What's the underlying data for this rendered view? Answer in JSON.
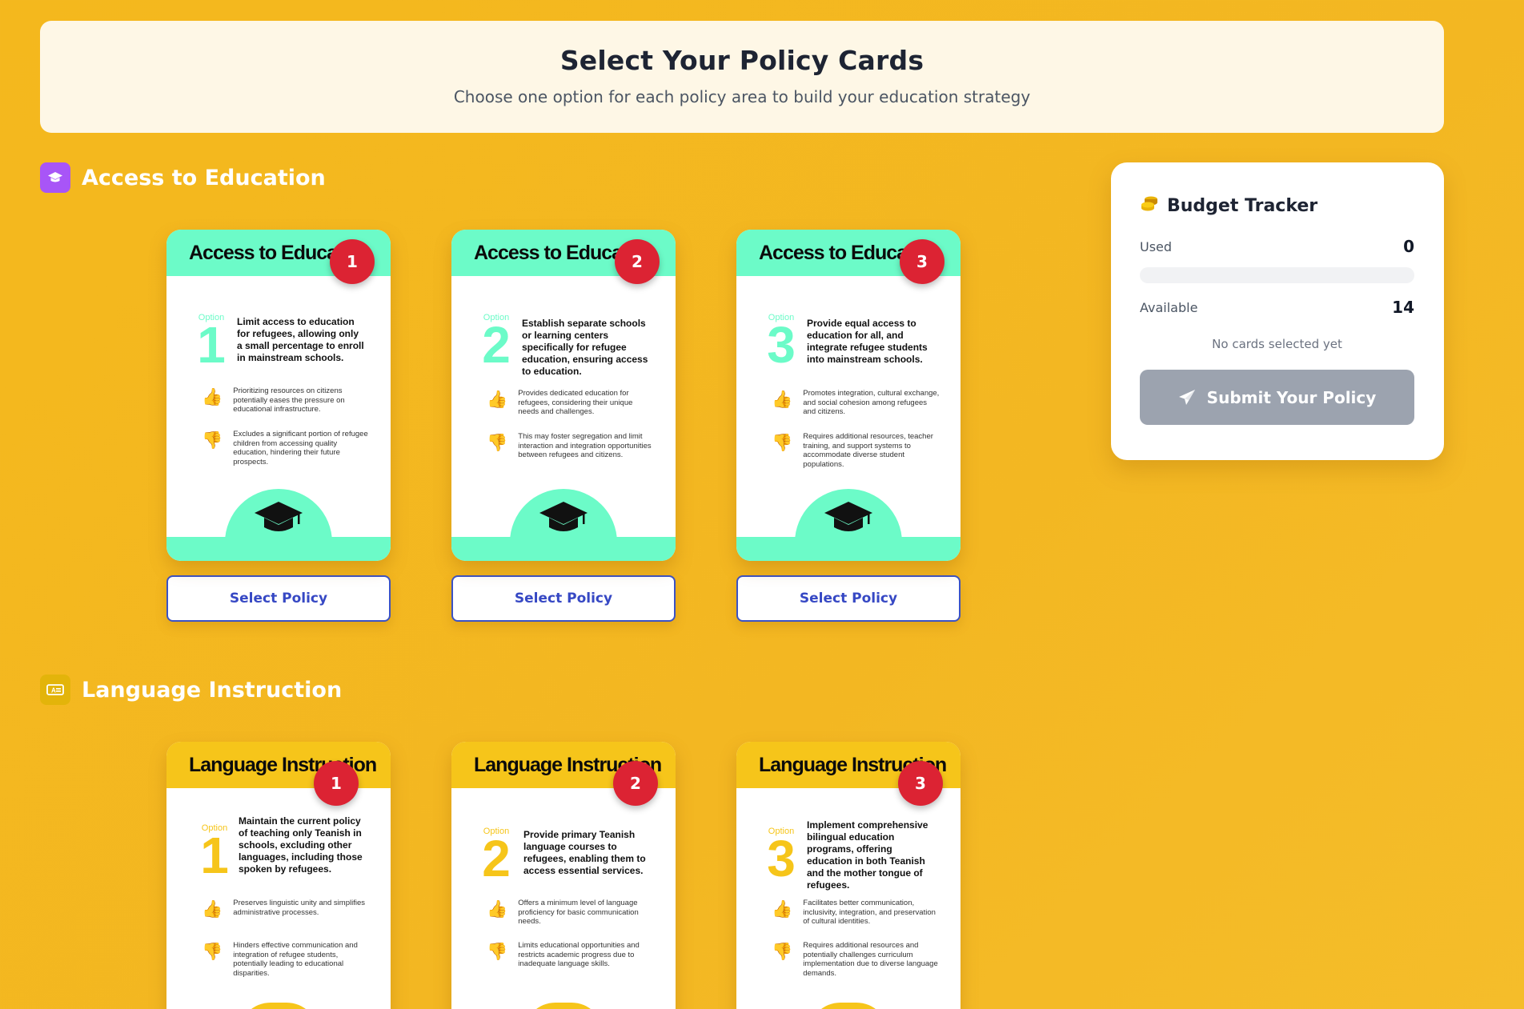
{
  "header": {
    "title": "Select Your Policy Cards",
    "subtitle": "Choose one option for each policy area to build your education strategy"
  },
  "sections": [
    {
      "title": "Access to Education",
      "icon": "graduation-cap-icon",
      "icon_bg": "#a855f7",
      "accent": "#6cfbc8",
      "cards": [
        {
          "header": "Access to Education",
          "badge": "1",
          "option_label": "Option",
          "option_number": "1",
          "title": "Limit access to education for refugees, allowing only a small percentage to enroll in mainstream schools.",
          "pro": "Prioritizing resources on citizens potentially eases the pressure on educational infrastructure.",
          "con": "Excludes a significant portion of refugee children from accessing quality education, hindering their future prospects.",
          "button": "Select Policy"
        },
        {
          "header": "Access to Education",
          "badge": "2",
          "option_label": "Option",
          "option_number": "2",
          "title": "Establish separate schools or learning centers specifically for refugee education, ensuring access to education.",
          "pro": "Provides dedicated education for refugees, considering their unique needs and challenges.",
          "con": "This may foster segregation and limit interaction and integration opportunities between refugees and citizens.",
          "button": "Select Policy"
        },
        {
          "header": "Access to Education",
          "badge": "3",
          "option_label": "Option",
          "option_number": "3",
          "title": "Provide equal access to education for all, and integrate refugee students into mainstream schools.",
          "pro": "Promotes integration, cultural exchange, and social cohesion among refugees and citizens.",
          "con": "Requires additional resources, teacher training, and support systems to accommodate diverse student populations.",
          "button": "Select Policy"
        }
      ]
    },
    {
      "title": "Language Instruction",
      "icon": "language-icon",
      "icon_bg": "#e3b40a",
      "accent": "#f6c51a",
      "cards": [
        {
          "header": "Language Instruction",
          "badge": "1",
          "option_label": "Option",
          "option_number": "1",
          "title": "Maintain the current policy of teaching only Teanish in schools, excluding other languages, including those spoken by refugees.",
          "pro": "Preserves linguistic unity and simplifies administrative processes.",
          "con": "Hinders effective communication and integration of refugee students, potentially leading to educational disparities."
        },
        {
          "header": "Language Instruction",
          "badge": "2",
          "option_label": "Option",
          "option_number": "2",
          "title": "Provide primary Teanish language courses to refugees, enabling them to access essential services.",
          "pro": "Offers a minimum level of language proficiency for basic communication needs.",
          "con": "Limits educational opportunities and restricts academic progress due to inadequate language skills."
        },
        {
          "header": "Language Instruction",
          "badge": "3",
          "option_label": "Option",
          "option_number": "3",
          "title": "Implement comprehensive bilingual education programs, offering education in both Teanish and the mother tongue of refugees.",
          "pro": "Facilitates better communication, inclusivity, integration, and preservation of cultural identities.",
          "con": "Requires additional resources and potentially challenges curriculum implementation due to diverse language demands."
        }
      ]
    }
  ],
  "tracker": {
    "title": "Budget Tracker",
    "icon": "coins-icon",
    "used_label": "Used",
    "used_value": "0",
    "used_fraction": 0,
    "available_label": "Available",
    "available_value": "14",
    "empty_message": "No cards selected yet",
    "submit_label": "Submit Your Policy"
  }
}
